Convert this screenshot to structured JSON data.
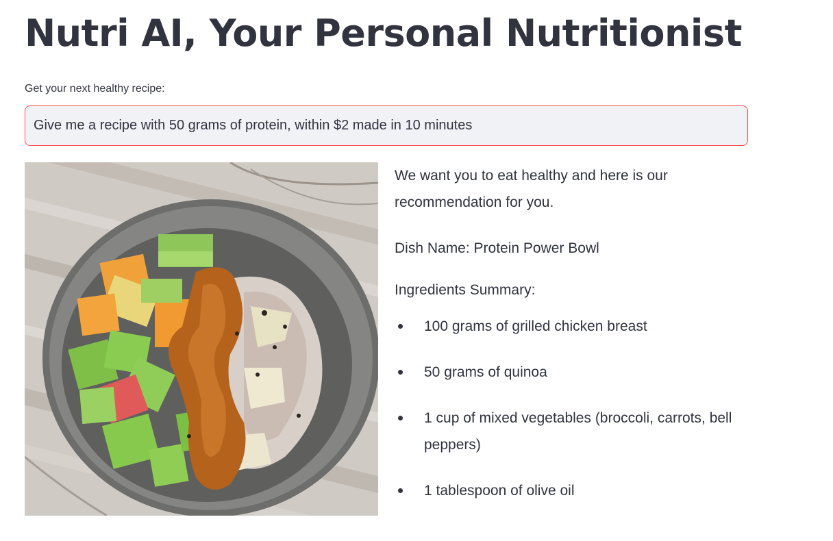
{
  "header": {
    "title": "Nutri AI, Your Personal Nutritionist"
  },
  "prompt": {
    "label": "Get your next healthy recipe:",
    "value": "Give me a recipe with 50 grams of protein, within $2 made in 10 minutes",
    "border_color": "#ff4b4b",
    "background_color": "#f0f2f6"
  },
  "recommendation": {
    "intro": "We want you to eat healthy and here is our recommendation for you.",
    "dish_name": "Dish Name: Protein Power Bowl",
    "summary_label": "Ingredients Summary:",
    "ingredients": [
      "100 grams of grilled chicken breast",
      "50 grams of quinoa",
      "1 cup of mixed vegetables (broccoli, carrots, bell peppers)",
      "1 tablespoon of olive oil"
    ]
  },
  "colors": {
    "text": "#31333f",
    "background": "#ffffff"
  }
}
